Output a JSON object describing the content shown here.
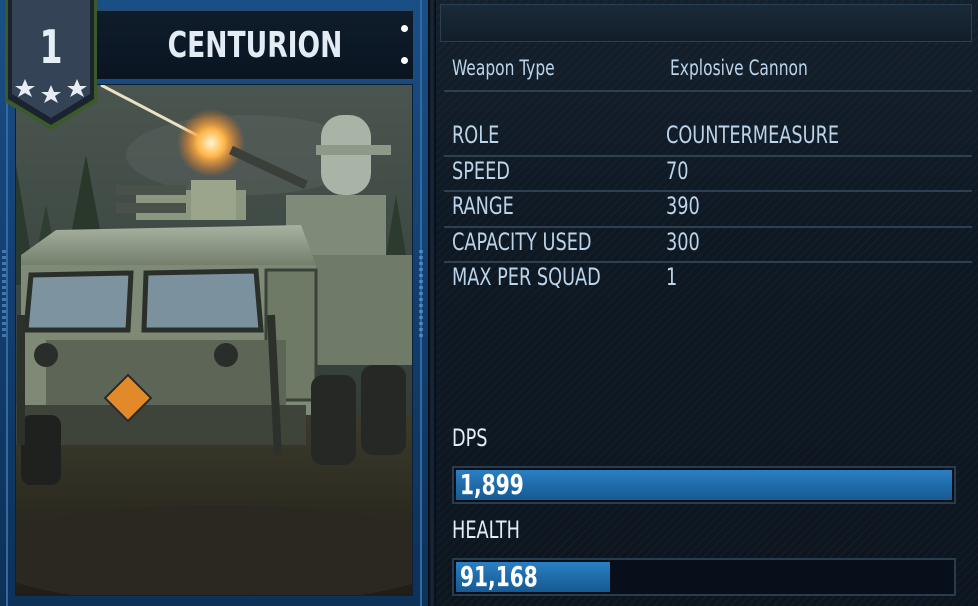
{
  "unit": {
    "name": "CENTURION",
    "tier": "1",
    "stars": 3,
    "image_alt": "armored military truck with mounted cannon and gun turret firing"
  },
  "weapon": {
    "label": "Weapon Type",
    "value": "Explosive Cannon"
  },
  "stats": [
    {
      "label": "ROLE",
      "value": "COUNTERMEASURE"
    },
    {
      "label": "SPEED",
      "value": "70"
    },
    {
      "label": "RANGE",
      "value": "390"
    },
    {
      "label": "CAPACITY USED",
      "value": "300"
    },
    {
      "label": "MAX PER SQUAD",
      "value": "1"
    }
  ],
  "bars": {
    "dps": {
      "label": "DPS",
      "value": "1,899",
      "fill_fraction": 1.0
    },
    "health": {
      "label": "HEALTH",
      "value": "91,168",
      "fill_fraction": 0.31
    }
  },
  "colors": {
    "card_blue": "#1a4f86",
    "bar_fill": "#1e6aa8",
    "panel_bg": "#0e1823",
    "text": "#bcd4ea",
    "badge_green": "#3b5a2c"
  }
}
